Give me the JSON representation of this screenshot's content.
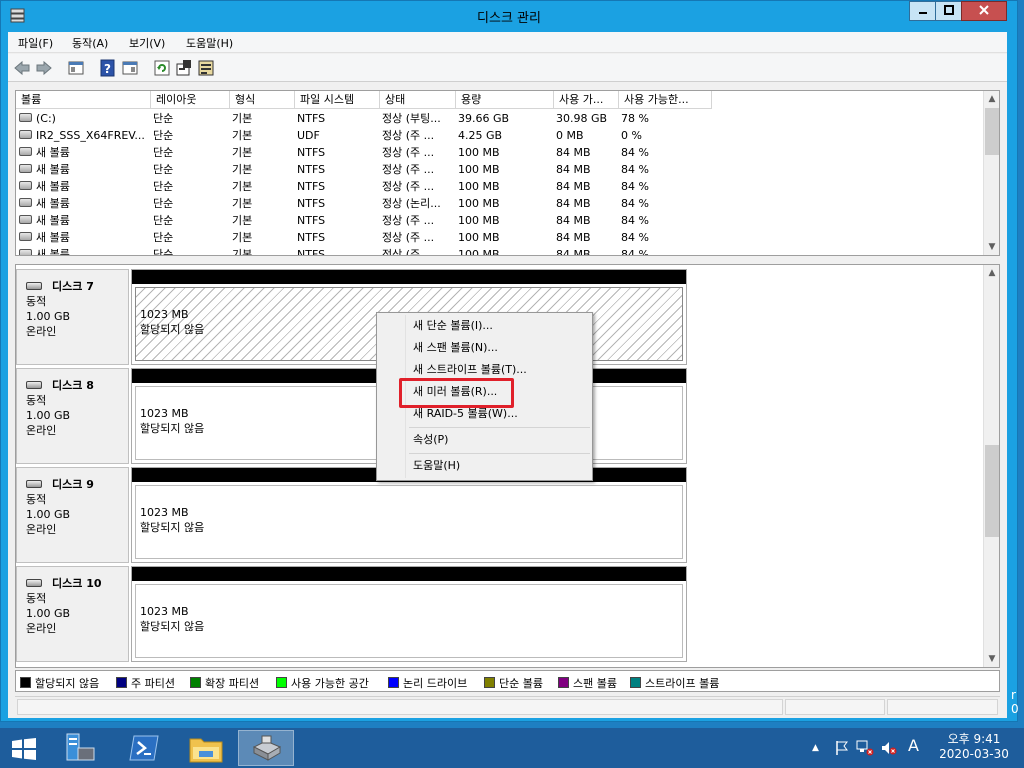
{
  "window": {
    "title": "디스크 관리"
  },
  "menubar": {
    "items": [
      "파일(F)",
      "동작(A)",
      "보기(V)",
      "도움말(H)"
    ]
  },
  "volume_table": {
    "columns": [
      "볼륨",
      "레이아웃",
      "형식",
      "파일 시스템",
      "상태",
      "용량",
      "사용 가...",
      "사용 가능한..."
    ],
    "rows": [
      [
        "(C:)",
        "단순",
        "기본",
        "NTFS",
        "정상 (부팅...",
        "39.66 GB",
        "30.98 GB",
        "78 %"
      ],
      [
        "IR2_SSS_X64FREV...",
        "단순",
        "기본",
        "UDF",
        "정상 (주 ...",
        "4.25 GB",
        "0 MB",
        "0 %"
      ],
      [
        "새 볼륨",
        "단순",
        "기본",
        "NTFS",
        "정상 (주 ...",
        "100 MB",
        "84 MB",
        "84 %"
      ],
      [
        "새 볼륨",
        "단순",
        "기본",
        "NTFS",
        "정상 (주 ...",
        "100 MB",
        "84 MB",
        "84 %"
      ],
      [
        "새 볼륨",
        "단순",
        "기본",
        "NTFS",
        "정상 (주 ...",
        "100 MB",
        "84 MB",
        "84 %"
      ],
      [
        "새 볼륨",
        "단순",
        "기본",
        "NTFS",
        "정상 (논리...",
        "100 MB",
        "84 MB",
        "84 %"
      ],
      [
        "새 볼륨",
        "단순",
        "기본",
        "NTFS",
        "정상 (주 ...",
        "100 MB",
        "84 MB",
        "84 %"
      ],
      [
        "새 볼륨",
        "단순",
        "기본",
        "NTFS",
        "정상 (주 ...",
        "100 MB",
        "84 MB",
        "84 %"
      ],
      [
        "새 볼륨",
        "단순",
        "기본",
        "NTFS",
        "정상 (주 ...",
        "100 MB",
        "84 MB",
        "84 %"
      ]
    ]
  },
  "disks": [
    {
      "name": "디스크 7",
      "type": "동적",
      "size": "1.00 GB",
      "status": "온라인",
      "partition_size": "1023 MB",
      "partition_status": "할당되지 않음"
    },
    {
      "name": "디스크 8",
      "type": "동적",
      "size": "1.00 GB",
      "status": "온라인",
      "partition_size": "1023 MB",
      "partition_status": "할당되지 않음"
    },
    {
      "name": "디스크 9",
      "type": "동적",
      "size": "1.00 GB",
      "status": "온라인",
      "partition_size": "1023 MB",
      "partition_status": "할당되지 않음"
    },
    {
      "name": "디스크 10",
      "type": "동적",
      "size": "1.00 GB",
      "status": "온라인",
      "partition_size": "1023 MB",
      "partition_status": "할당되지 않음"
    }
  ],
  "context_menu": {
    "items": [
      "새 단순 볼륨(I)...",
      "새 스팬 볼륨(N)...",
      "새 스트라이프 볼륨(T)...",
      "새 미러 볼륨(R)...",
      "새 RAID-5 볼륨(W)...",
      "속성(P)",
      "도움말(H)"
    ],
    "highlighted": "새 미러 볼륨(R)..."
  },
  "legend": [
    {
      "label": "할당되지 않음",
      "color": "#000000"
    },
    {
      "label": "주 파티션",
      "color": "#000080"
    },
    {
      "label": "확장 파티션",
      "color": "#008000"
    },
    {
      "label": "사용 가능한 공간",
      "color": "#00ff00"
    },
    {
      "label": "논리 드라이브",
      "color": "#0000ff"
    },
    {
      "label": "단순 볼륨",
      "color": "#808000"
    },
    {
      "label": "스팬 볼륨",
      "color": "#800080"
    },
    {
      "label": "스트라이프 볼륨",
      "color": "#008080"
    }
  ],
  "taskbar": {
    "clock_time": "오후 9:41",
    "clock_date": "2020-03-30",
    "ime_indicator": "A"
  },
  "desktop_edge_text": "r\n0"
}
